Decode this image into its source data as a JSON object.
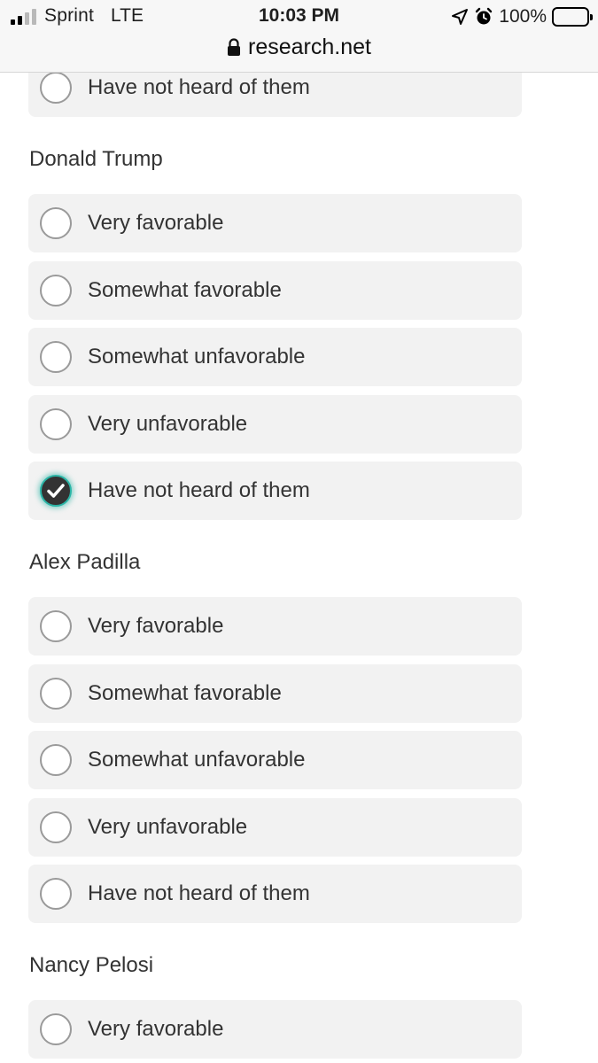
{
  "status_bar": {
    "carrier": "Sprint",
    "network": "LTE",
    "time": "10:03 PM",
    "battery": "100%",
    "icons": [
      "signal-bars-icon",
      "location-arrow-icon",
      "alarm-clock-icon",
      "battery-icon"
    ]
  },
  "browser": {
    "url": "research.net",
    "icon": "lock-icon"
  },
  "survey": {
    "partial_option": {
      "label": "Have not heard of them"
    },
    "questions": [
      {
        "name": "Donald Trump",
        "options": [
          {
            "label": "Very favorable",
            "checked": false
          },
          {
            "label": "Somewhat favorable",
            "checked": false
          },
          {
            "label": "Somewhat unfavorable",
            "checked": false
          },
          {
            "label": "Very unfavorable",
            "checked": false
          },
          {
            "label": "Have not heard of them",
            "checked": true
          }
        ]
      },
      {
        "name": "Alex Padilla",
        "options": [
          {
            "label": "Very favorable",
            "checked": false
          },
          {
            "label": "Somewhat favorable",
            "checked": false
          },
          {
            "label": "Somewhat unfavorable",
            "checked": false
          },
          {
            "label": "Very unfavorable",
            "checked": false
          },
          {
            "label": "Have not heard of them",
            "checked": false
          }
        ]
      },
      {
        "name": "Nancy Pelosi",
        "options": [
          {
            "label": "Very favorable",
            "checked": false
          }
        ]
      }
    ]
  },
  "colors": {
    "option_bg": "#f2f2f2",
    "checked_fill": "#333333",
    "checked_glow": "#2bb5a6",
    "text": "#333333"
  }
}
